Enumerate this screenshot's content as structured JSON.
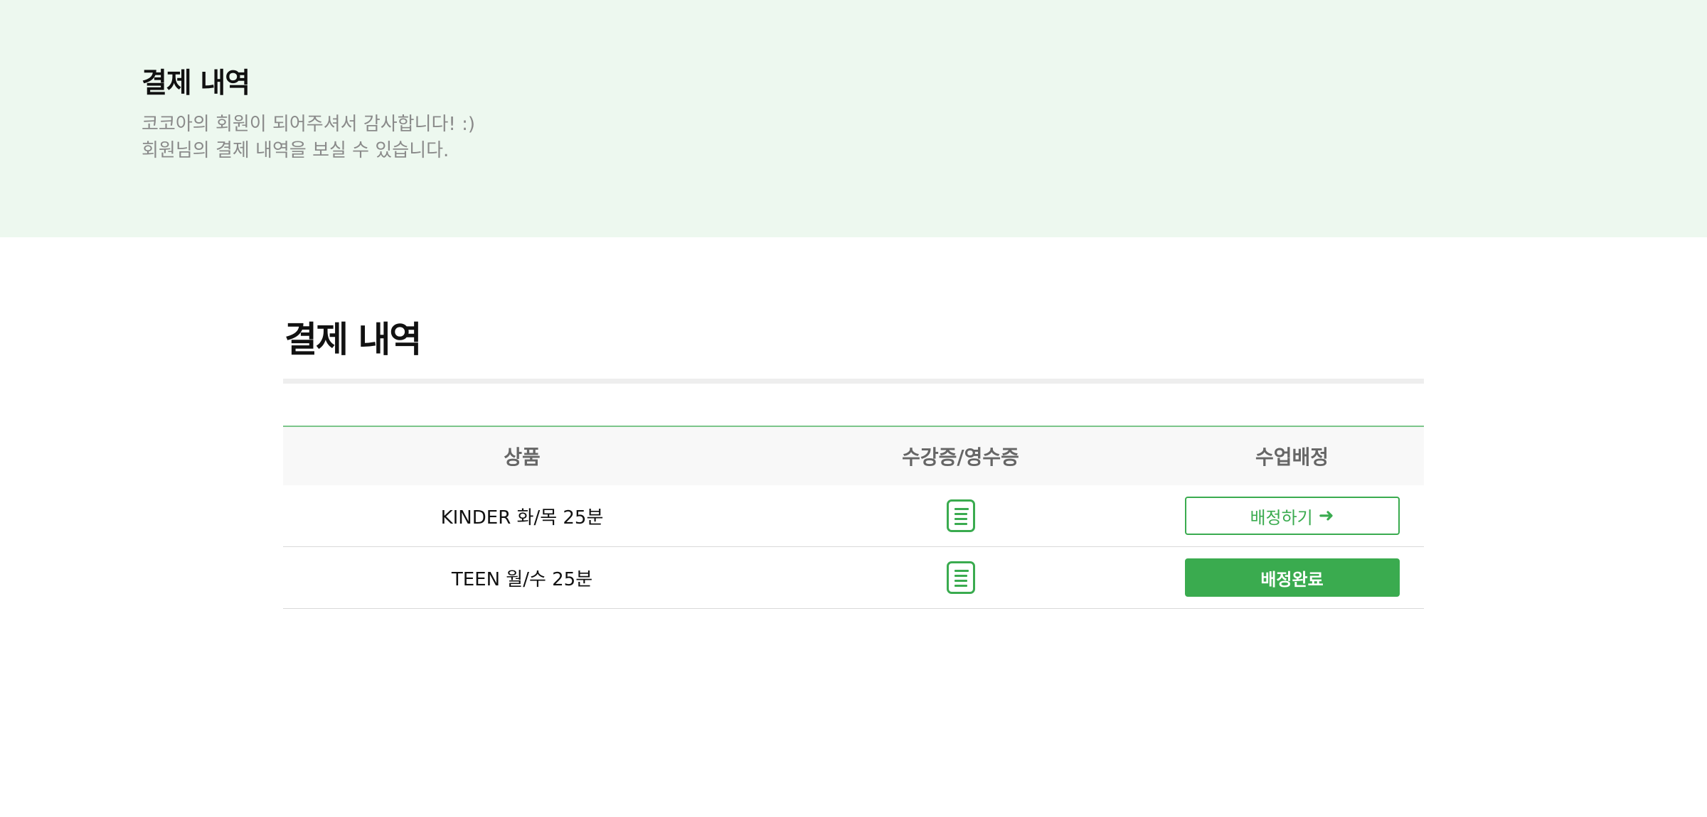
{
  "hero": {
    "title": "결제 내역",
    "desc_line1": "코코아의 회원이 되어주셔서 감사합니다! :)",
    "desc_line2": "회원님의 결제 내역을 보실 수 있습니다."
  },
  "section": {
    "title": "결제 내역"
  },
  "table": {
    "headers": [
      "상품",
      "수강증/영수증",
      "수업배정"
    ],
    "rows": [
      {
        "product": "KINDER 화/목 25분",
        "receipt_icon": "document-icon",
        "action_label": "배정하기",
        "action_icon": "arrow-right-icon",
        "action_state": "pending"
      },
      {
        "product": "TEEN 월/수 25분",
        "receipt_icon": "document-icon",
        "action_label": "배정완료",
        "action_state": "completed"
      }
    ]
  },
  "colors": {
    "accent": "#3aab4f",
    "hero_bg": "#edf8ef",
    "highlight": "#c9ebd0"
  }
}
